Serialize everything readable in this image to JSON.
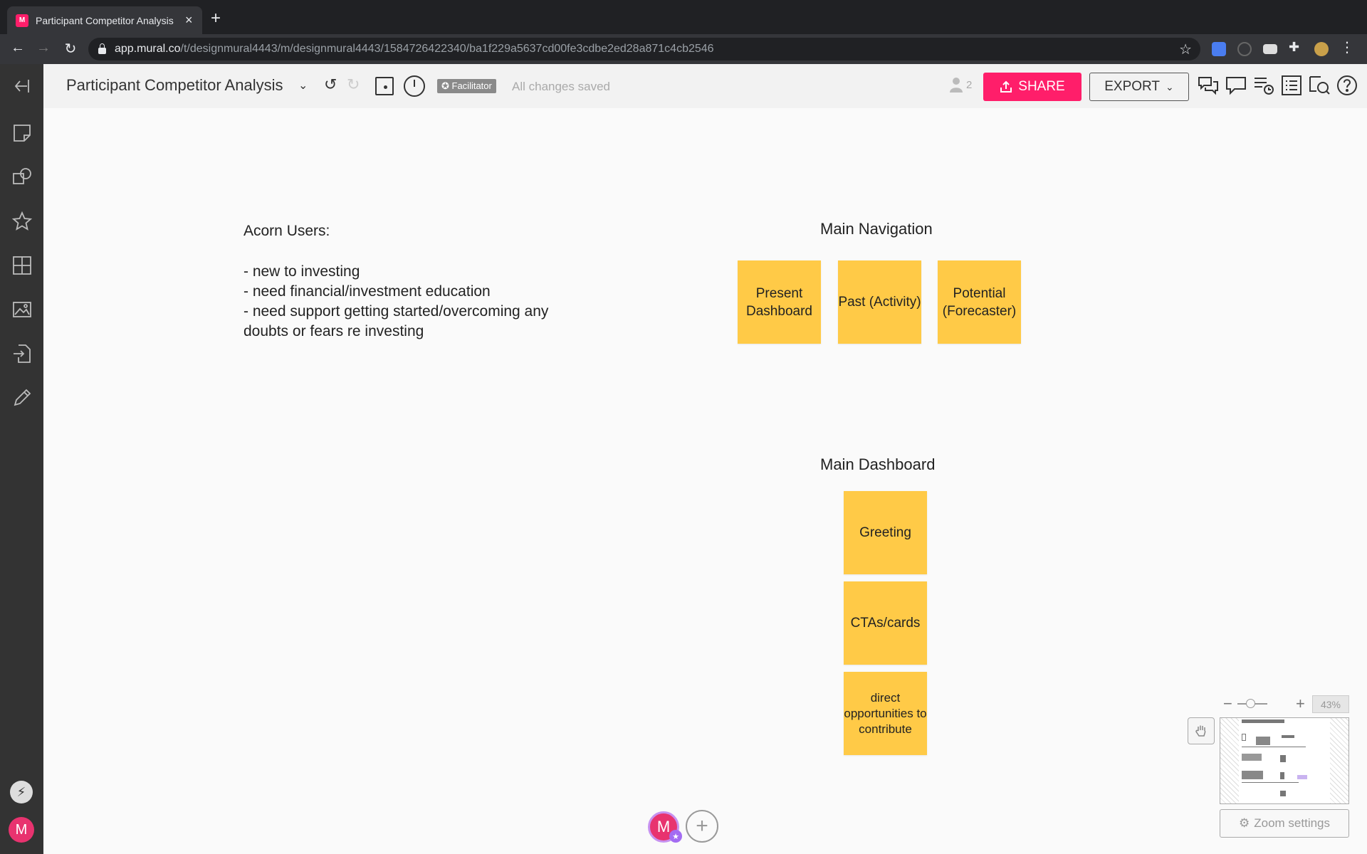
{
  "browser": {
    "tab_title": "Participant Competitor Analysis",
    "tab_close": "×",
    "new_tab": "+",
    "url_host": "app.mural.co",
    "url_path": "/t/designmural4443/m/designmural4443/1584726422340/ba1f229a5637cd00fe3cdbe2ed28a871c4cb2546"
  },
  "toolbar": {
    "mural_title": "Participant Competitor Analysis",
    "facilitator_label": "✪ Facilitator",
    "save_status": "All changes saved",
    "participants_count": "2",
    "share_label": "SHARE",
    "export_label": "EXPORT"
  },
  "canvas": {
    "users_text": {
      "title": "Acorn Users:",
      "lines": [
        "- new to investing",
        "- need financial/investment education",
        "- need support getting started/overcoming any",
        "doubts or fears re investing"
      ]
    },
    "main_navigation": {
      "heading": "Main Navigation",
      "stickies": [
        "Present Dashboard",
        "Past (Activity)",
        "Potential (Forecaster)"
      ]
    },
    "main_dashboard": {
      "heading": "Main Dashboard",
      "stickies": [
        "Greeting",
        "CTAs/cards",
        "direct opportunities to contribute"
      ]
    }
  },
  "collaborators": {
    "avatar_initial": "M",
    "add_label": "+"
  },
  "sidebar": {
    "user_initial": "M"
  },
  "zoom": {
    "level": "43%",
    "settings_label": "Zoom settings"
  },
  "colors": {
    "accent": "#ff1e6a",
    "sticky": "#ffca47",
    "sidebar": "#333333"
  }
}
